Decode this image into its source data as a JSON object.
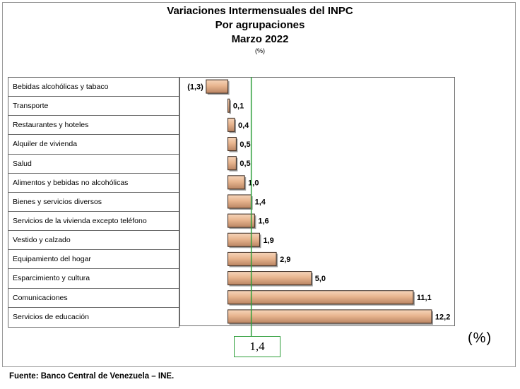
{
  "chart_data": {
    "type": "bar",
    "orientation": "horizontal",
    "title": [
      "Variaciones Intermensuales del INPC",
      "Por agrupaciones",
      "Marzo 2022"
    ],
    "unit_note": "(%)",
    "categories": [
      "Bebidas alcohólicas y tabaco",
      "Transporte",
      "Restaurantes y hoteles",
      "Alquiler de vivienda",
      "Salud",
      "Alimentos y bebidas no alcohólicas",
      "Bienes y servicios diversos",
      "Servicios de la vivienda excepto teléfono",
      "Vestido y calzado",
      "Equipamiento del hogar",
      "Esparcimiento y cultura",
      "Comunicaciones",
      "Servicios de educación"
    ],
    "values": [
      -1.3,
      0.1,
      0.4,
      0.5,
      0.5,
      1.0,
      1.4,
      1.6,
      1.9,
      2.9,
      5.0,
      11.1,
      12.2
    ],
    "data_labels": [
      "(1,3)",
      "0,1",
      "0,4",
      "0,5",
      "0,5",
      "1,0",
      "1,4",
      "1,6",
      "1,9",
      "2,9",
      "5,0",
      "11,1",
      "12,2"
    ],
    "reference_line": {
      "value": 1.4,
      "label": "1,4",
      "color": "#2e9e3a"
    },
    "xlim": [
      -2.9,
      13.6
    ],
    "bar_color": "#e8b58f",
    "bar_edge_color": "#3a2a20",
    "axis_unit_label": "(%)",
    "source": "Fuente: Banco Central de Venezuela – INE."
  }
}
